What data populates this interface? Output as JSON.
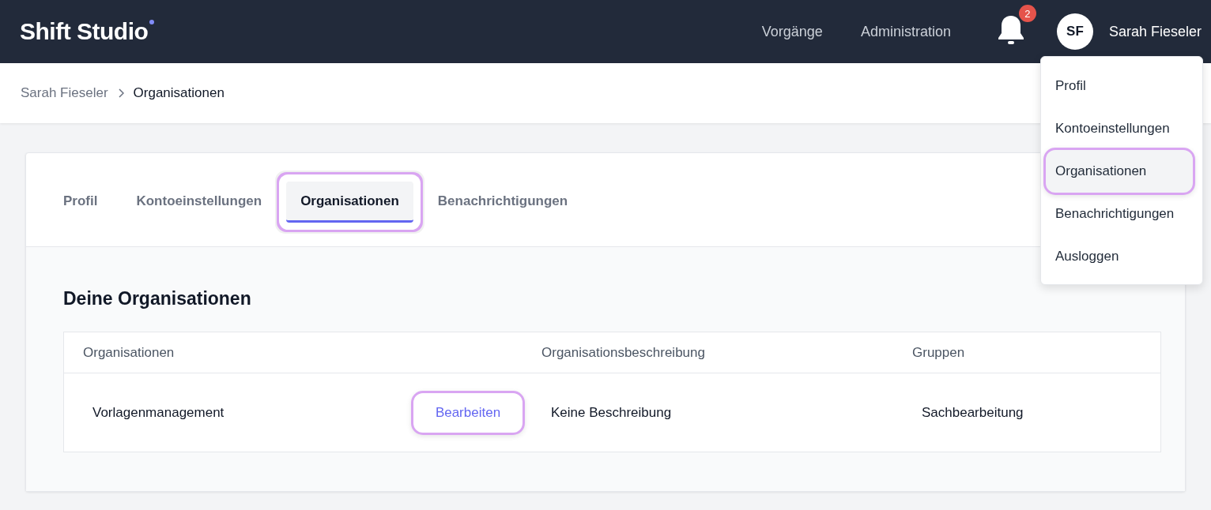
{
  "header": {
    "logo": "Shift Studio",
    "nav": [
      {
        "label": "Vorgänge"
      },
      {
        "label": "Administration"
      }
    ],
    "notifications": {
      "count": "2"
    },
    "user": {
      "initials": "SF",
      "name": "Sarah Fieseler"
    }
  },
  "breadcrumb": [
    {
      "label": "Sarah Fieseler",
      "current": false
    },
    {
      "label": "Organisationen",
      "current": true
    }
  ],
  "user_menu": {
    "items": [
      {
        "label": "Profil",
        "selected": false,
        "highlighted": false
      },
      {
        "label": "Kontoeinstellungen",
        "selected": false,
        "highlighted": false
      },
      {
        "label": "Organisationen",
        "selected": true,
        "highlighted": true
      },
      {
        "label": "Benachrichtigungen",
        "selected": false,
        "highlighted": false
      },
      {
        "label": "Ausloggen",
        "selected": false,
        "highlighted": false
      }
    ]
  },
  "tabs": [
    {
      "label": "Profil",
      "selected": false,
      "highlighted": false
    },
    {
      "label": "Kontoeinstellungen",
      "selected": false,
      "highlighted": false
    },
    {
      "label": "Organisationen",
      "selected": true,
      "highlighted": true
    },
    {
      "label": "Benachrichtigungen",
      "selected": false,
      "highlighted": false
    }
  ],
  "section": {
    "title": "Deine Organisationen"
  },
  "table": {
    "columns": [
      "Organisationen",
      "Organisationsbeschreibung",
      "Gruppen"
    ],
    "rows": [
      {
        "organization": "Vorlagenmanagement",
        "action": {
          "label": "Bearbeiten",
          "highlighted": true
        },
        "description": "Keine Beschreibung",
        "groups": "Sachbearbeitung"
      }
    ]
  }
}
